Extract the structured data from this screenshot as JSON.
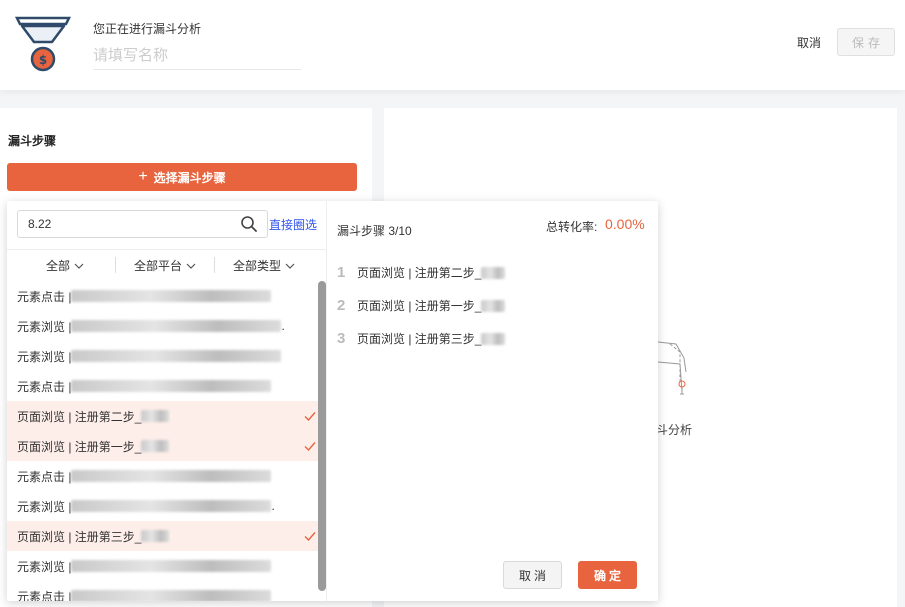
{
  "header": {
    "subtitle": "您正在进行漏斗分析",
    "name_placeholder": "请填写名称",
    "cancel_label": "取消",
    "save_label": "保存"
  },
  "left": {
    "section_title": "漏斗步骤",
    "select_button_label": "选择漏斗步骤",
    "select_button_icon": "plus-icon"
  },
  "background": {
    "empty_text": "斗分析"
  },
  "picker": {
    "search_value": "8.22",
    "direct_link": "直接圈选",
    "filters": [
      "全部",
      "全部平台",
      "全部类型"
    ],
    "items": [
      {
        "prefix": "元素点击 | ",
        "suffix": "",
        "selected": false
      },
      {
        "prefix": "元素浏览 | ",
        "suffix": ".",
        "selected": false
      },
      {
        "prefix": "元素浏览 | ",
        "suffix": "",
        "selected": false
      },
      {
        "prefix": "元素点击 | ",
        "suffix": "",
        "selected": false
      },
      {
        "prefix": "页面浏览 | 注册第二步_",
        "suffix": "",
        "selected": true
      },
      {
        "prefix": "页面浏览 | 注册第一步_",
        "suffix": "",
        "selected": true
      },
      {
        "prefix": "元素点击 | ",
        "suffix": "",
        "selected": false
      },
      {
        "prefix": "元素浏览 | ",
        "suffix": ".",
        "selected": false
      },
      {
        "prefix": "页面浏览 | 注册第三步_",
        "suffix": "",
        "selected": true
      },
      {
        "prefix": "元素浏览 | ",
        "suffix": "",
        "selected": false
      },
      {
        "prefix": "元素点击 | ",
        "suffix": "",
        "selected": false
      }
    ],
    "steps_count": "漏斗步骤 3/10",
    "conversion_label": "总转化率:",
    "conversion_value": "0.00%",
    "steps": [
      {
        "num": "1",
        "text": "页面浏览 | 注册第二步_"
      },
      {
        "num": "2",
        "text": "页面浏览 | 注册第一步_"
      },
      {
        "num": "3",
        "text": "页面浏览 | 注册第三步_"
      }
    ],
    "cancel_label": "取消",
    "ok_label": "确定"
  },
  "colors": {
    "accent": "#e8643e",
    "link": "#2f54eb",
    "selected_bg": "#fdeeea"
  }
}
